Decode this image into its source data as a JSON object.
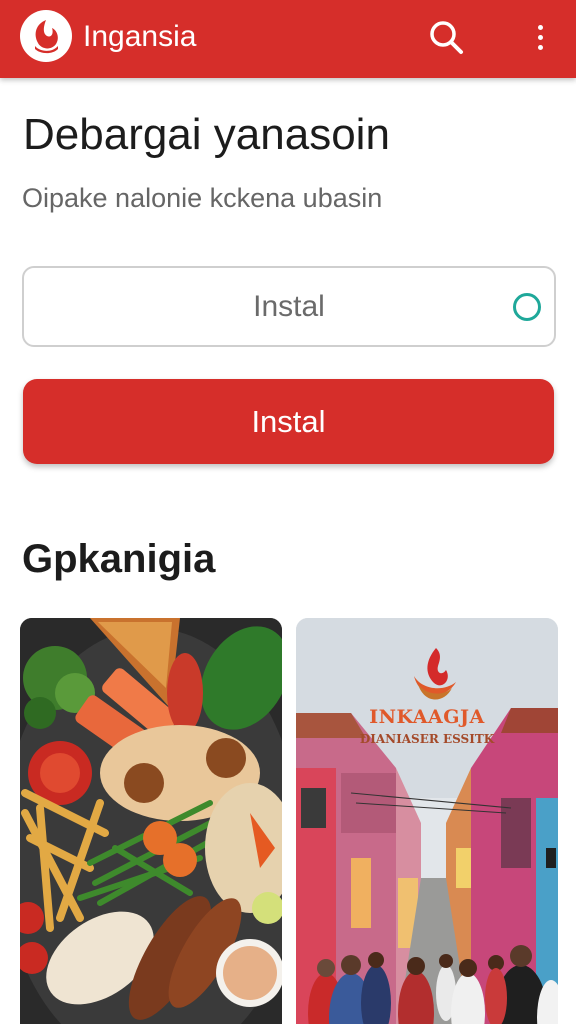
{
  "appbar": {
    "title": "Ingansia",
    "background": "#d62e2a",
    "icons": [
      "brand-logo-icon",
      "search-icon",
      "more-vert-icon"
    ]
  },
  "main": {
    "heading": "Debargai yanasoin",
    "subheading": "Oipake nalonie kckena ubasin",
    "input": {
      "placeholder": "Instal",
      "value": ""
    },
    "install_button": "Instal",
    "section_title": "Gpkanigia"
  },
  "cards": [
    {
      "kind": "food-platter-photo"
    },
    {
      "kind": "street-market-photo",
      "brand": "INKAAGJA",
      "tagline": "DIANIASER ESSITK"
    }
  ],
  "colors": {
    "accent": "#d62e2a",
    "status_ring": "#1fa89a"
  }
}
